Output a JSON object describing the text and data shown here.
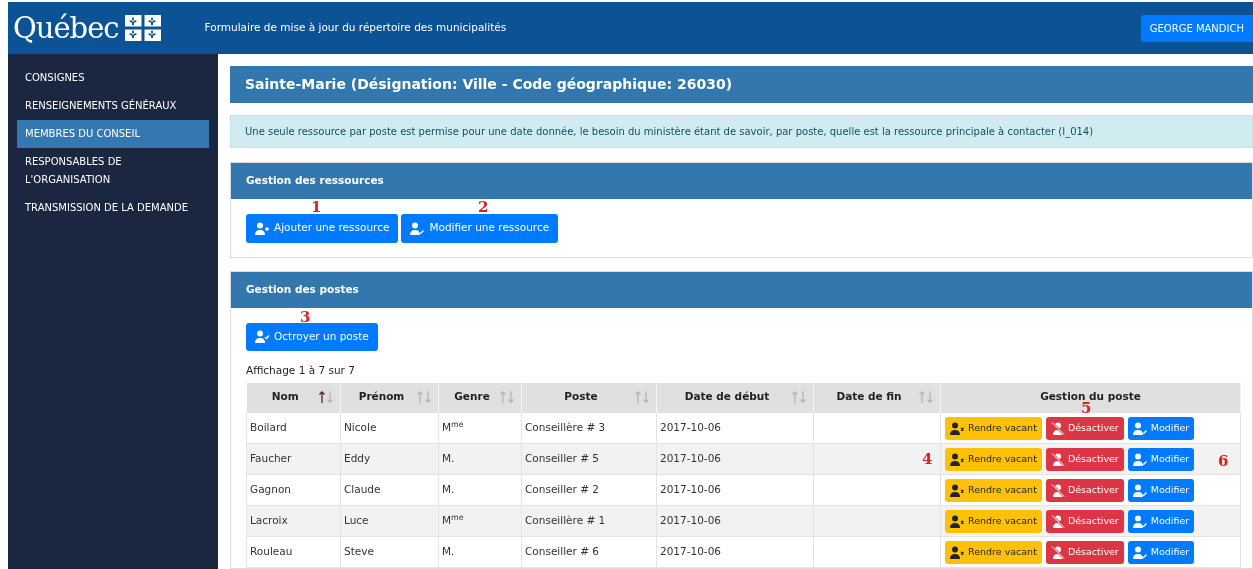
{
  "header": {
    "logo": "Québec",
    "title": "Formulaire de mise à jour du répertoire des municipalités",
    "user": "GEORGE MANDICH"
  },
  "sidebar": {
    "items": [
      {
        "label": "CONSIGNES",
        "selected": false
      },
      {
        "label": "RENSEIGNEMENTS GÉNÉRAUX",
        "selected": false
      },
      {
        "label": "MEMBRES DU CONSEIL",
        "selected": true
      },
      {
        "label": "RESPONSABLES DE L'ORGANISATION",
        "selected": false
      },
      {
        "label": "TRANSMISSION DE LA DEMANDE",
        "selected": false
      }
    ]
  },
  "page_title": "Sainte-Marie (Désignation: Ville - Code géographique: 26030)",
  "notice": "Une seule ressource par poste est permise pour une date donnée, le besoin du ministère étant de savoir, par poste, quelle est la ressource principale à contacter (I_014)",
  "resources": {
    "title": "Gestion des ressources",
    "buttons": [
      {
        "label": "Ajouter une ressource",
        "kind": "add"
      },
      {
        "label": "Modifier une ressource",
        "kind": "edit"
      }
    ]
  },
  "posts": {
    "title": "Gestion des postes",
    "button": "Octroyer un poste",
    "count": "Affichage 1 à 7 sur 7",
    "table": {
      "columns": [
        {
          "label": "Nom",
          "sorted_asc": true
        },
        {
          "label": "Prénom",
          "sorted_asc": false
        },
        {
          "label": "Genre",
          "sorted_asc": false
        },
        {
          "label": "Poste",
          "sorted_asc": false
        },
        {
          "label": "Date de début",
          "sorted_asc": false
        },
        {
          "label": "Date de fin",
          "sorted_asc": false
        },
        {
          "label": "Gestion du poste"
        }
      ],
      "rows": [
        {
          "cells": [
            "Boilard",
            "Nicole",
            "M$^{me}$",
            "Conseillère # 3",
            "2017-10-06",
            ""
          ],
          "actions": [
            {
              "label": "Rendre vacant",
              "kind": "vacate"
            },
            {
              "label": "Désactiver",
              "kind": "deactivate"
            },
            {
              "label": "Modifier",
              "kind": "modify"
            }
          ]
        },
        {
          "cells": [
            "Faucher",
            "Eddy",
            "M.",
            "Conseiller # 5",
            "2017-10-06",
            ""
          ],
          "actions": [
            {
              "label": "Rendre vacant",
              "kind": "vacate"
            },
            {
              "label": "Désactiver",
              "kind": "deactivate"
            },
            {
              "label": "Modifier",
              "kind": "modify"
            }
          ]
        },
        {
          "cells": [
            "Gagnon",
            "Claude",
            "M.",
            "Conseiller # 2",
            "2017-10-06",
            ""
          ],
          "actions": [
            {
              "label": "Rendre vacant",
              "kind": "vacate"
            },
            {
              "label": "Désactiver",
              "kind": "deactivate"
            },
            {
              "label": "Modifier",
              "kind": "modify"
            }
          ]
        },
        {
          "cells": [
            "Lacroix",
            "Luce",
            "M$^{me}$",
            "Conseillère # 1",
            "2017-10-06",
            ""
          ],
          "actions": [
            {
              "label": "Rendre vacant",
              "kind": "vacate"
            },
            {
              "label": "Désactiver",
              "kind": "deactivate"
            },
            {
              "label": "Modifier",
              "kind": "modify"
            }
          ]
        },
        {
          "cells": [
            "Rouleau",
            "Steve",
            "M.",
            "Conseiller # 6",
            "2017-10-06",
            ""
          ],
          "actions": [
            {
              "label": "Rendre vacant",
              "kind": "vacate"
            },
            {
              "label": "Désactiver",
              "kind": "deactivate"
            },
            {
              "label": "Modifier",
              "kind": "modify"
            }
          ]
        }
      ]
    }
  },
  "annotations": [
    "1",
    "2",
    "3",
    "4",
    "5",
    "6"
  ]
}
